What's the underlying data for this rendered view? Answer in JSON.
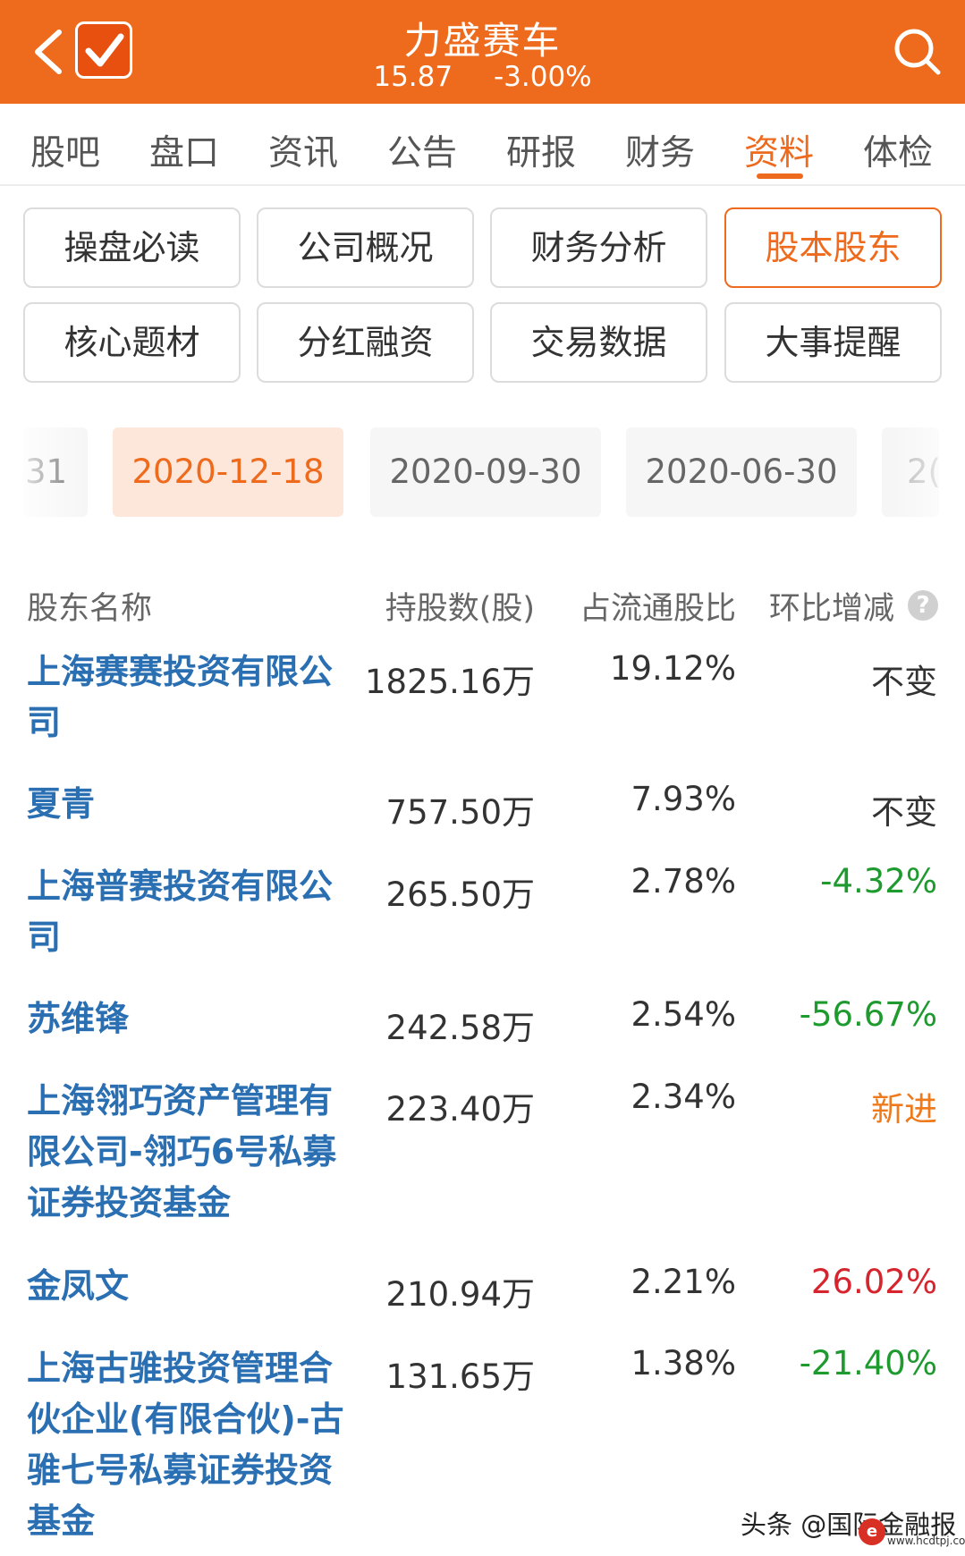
{
  "header": {
    "title": "力盛赛车",
    "price": "15.87",
    "change": "-3.00%",
    "bg_color": "#ee6a1c"
  },
  "tabs": [
    "股吧",
    "盘口",
    "资讯",
    "公告",
    "研报",
    "财务",
    "资料",
    "体检"
  ],
  "active_tab": "资料",
  "sub_buttons": [
    "操盘必读",
    "公司概况",
    "财务分析",
    "股本股东",
    "核心题材",
    "分红融资",
    "交易数据",
    "大事提醒"
  ],
  "active_sub_button": "股本股东",
  "dates": [
    "31",
    "2020-12-18",
    "2020-09-30",
    "2020-06-30",
    "2("
  ],
  "active_date": "2020-12-18",
  "table": {
    "headers": [
      "股东名称",
      "持股数(股)",
      "占流通股比",
      "环比增减"
    ],
    "rows": [
      {
        "name": "上海赛赛投资有限公司",
        "shares": "1825.16万",
        "ratio": "19.12%",
        "change": "不变",
        "change_color": "#333333"
      },
      {
        "name": "夏青",
        "shares": "757.50万",
        "ratio": "7.93%",
        "change": "不变",
        "change_color": "#333333"
      },
      {
        "name": "上海普赛投资有限公司",
        "shares": "265.50万",
        "ratio": "2.78%",
        "change": "-4.32%",
        "change_color": "#1e9a2e"
      },
      {
        "name": "苏维锋",
        "shares": "242.58万",
        "ratio": "2.54%",
        "change": "-56.67%",
        "change_color": "#1e9a2e"
      },
      {
        "name": "上海翎巧资产管理有限公司-翎巧6号私募证券投资基金",
        "shares": "223.40万",
        "ratio": "2.34%",
        "change": "新进",
        "change_color": "#ee7a1c"
      },
      {
        "name": "金凤文",
        "shares": "210.94万",
        "ratio": "2.21%",
        "change": "26.02%",
        "change_color": "#d6252e"
      },
      {
        "name": "上海古骓投资管理合伙企业(有限合伙)-古骓七号私募证券投资基金",
        "shares": "131.65万",
        "ratio": "1.38%",
        "change": "-21.40%",
        "change_color": "#1e9a2e"
      }
    ]
  },
  "watermark": {
    "text": "头条 @国际金融报",
    "logo": "e",
    "site": "www.hcdtpj.com"
  }
}
